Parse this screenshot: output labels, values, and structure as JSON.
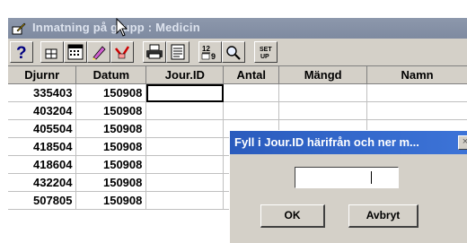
{
  "window": {
    "title": "Inmatning på grupp : Medicin"
  },
  "toolbar": {
    "buttons": [
      {
        "icon": "help-icon"
      },
      {
        "icon": "layout-icon"
      },
      {
        "icon": "calendar-icon"
      },
      {
        "icon": "pencil-icon"
      },
      {
        "icon": "eraser-icon"
      },
      {
        "icon": "printer-icon"
      },
      {
        "icon": "list-icon"
      },
      {
        "icon": "calc-icon"
      },
      {
        "icon": "magnify-icon"
      },
      {
        "icon": "settings-icon",
        "label": "SET UP"
      }
    ]
  },
  "grid": {
    "columns": [
      "Djurnr",
      "Datum",
      "Jour.ID",
      "Antal",
      "Mängd",
      "Namn"
    ],
    "rows": [
      {
        "djurnr": "335403",
        "datum": "150908"
      },
      {
        "djurnr": "403204",
        "datum": "150908"
      },
      {
        "djurnr": "405504",
        "datum": "150908"
      },
      {
        "djurnr": "418504",
        "datum": "150908"
      },
      {
        "djurnr": "418604",
        "datum": "150908"
      },
      {
        "djurnr": "432204",
        "datum": "150908"
      },
      {
        "djurnr": "507805",
        "datum": "150908"
      }
    ]
  },
  "dialog": {
    "title": "Fyll i Jour.ID härifrån och ner m...",
    "close": "×",
    "input_value": "",
    "ok_label": "OK",
    "cancel_label": "Avbryt"
  }
}
